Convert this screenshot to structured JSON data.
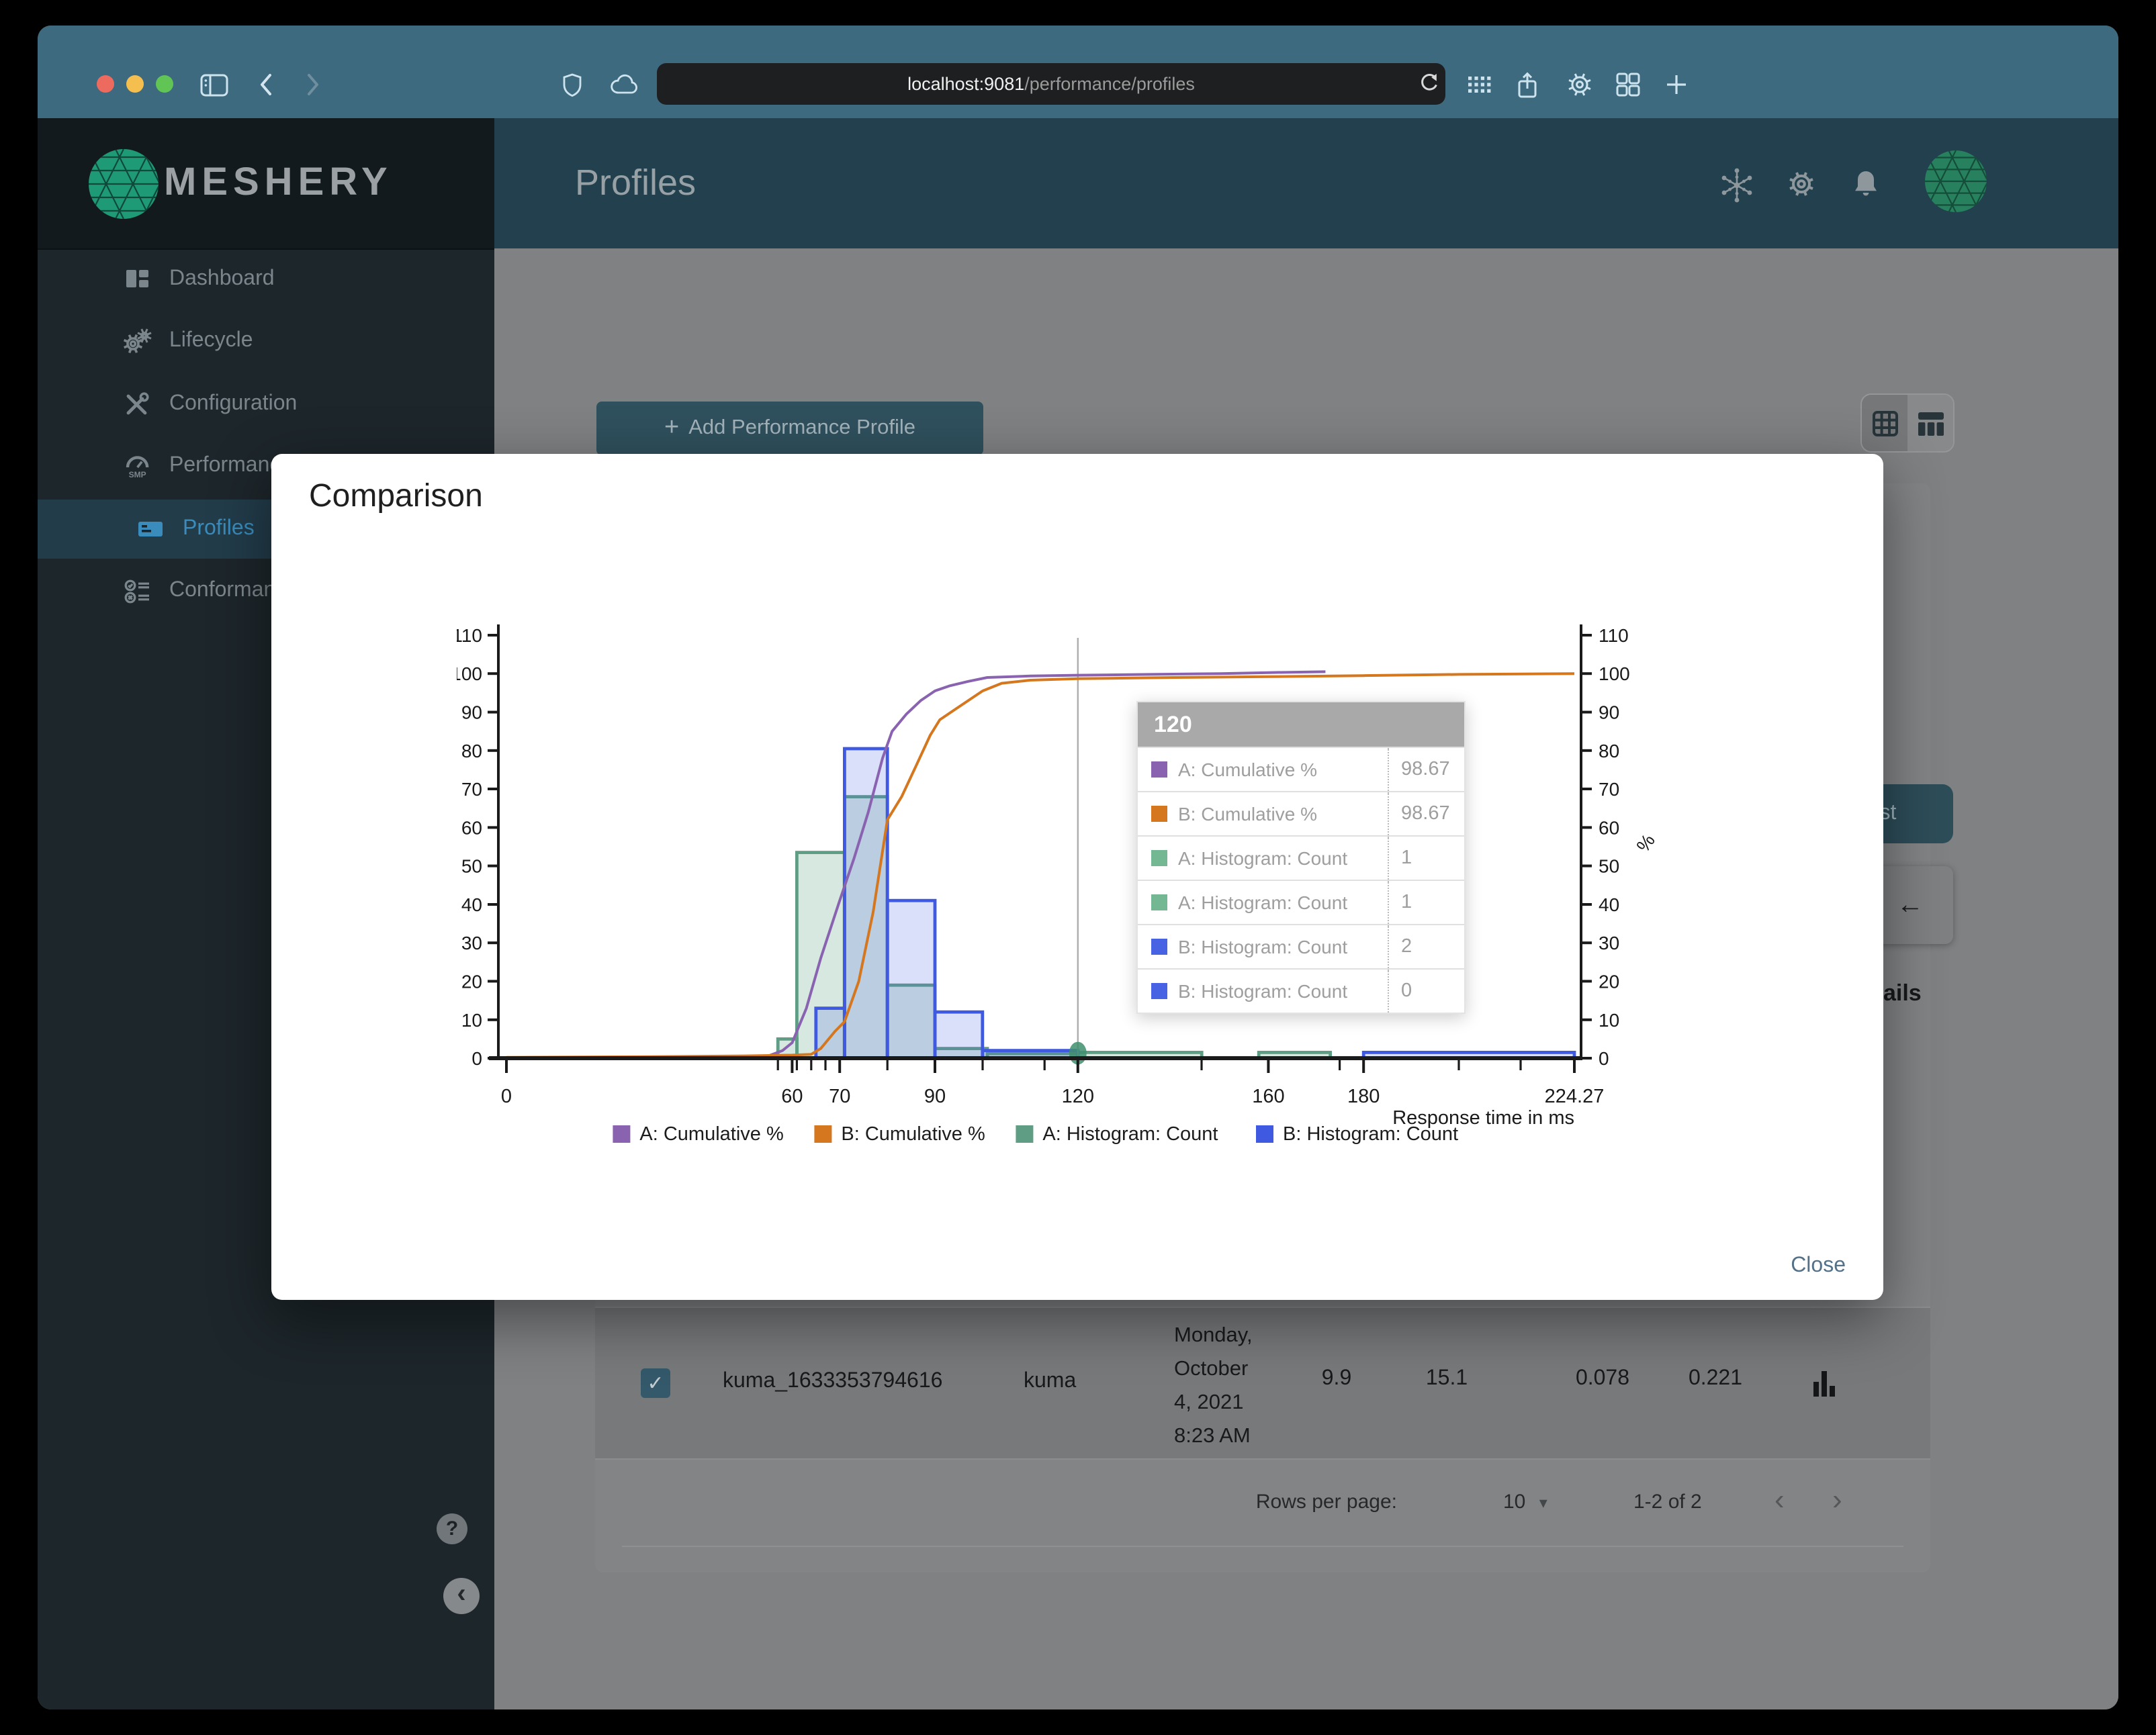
{
  "browser": {
    "url_host": "localhost:9081",
    "url_path": "/performance/profiles"
  },
  "sidebar": {
    "logo": "MESHERY",
    "items": [
      {
        "label": "Dashboard",
        "icon": "dashboard-icon",
        "active": false,
        "indent": false
      },
      {
        "label": "Lifecycle",
        "icon": "lifecycle-icon",
        "active": false,
        "indent": false
      },
      {
        "label": "Configuration",
        "icon": "configuration-icon",
        "active": false,
        "indent": false
      },
      {
        "label": "Performance",
        "icon": "performance-icon",
        "active": false,
        "indent": false,
        "icon_sub": "SMP"
      },
      {
        "label": "Profiles",
        "icon": "profiles-icon",
        "active": true,
        "indent": true
      },
      {
        "label": "Conformance",
        "icon": "conformance-icon",
        "active": false,
        "indent": false
      }
    ],
    "help_glyph": "?",
    "collapse_glyph": "‹"
  },
  "header": {
    "title": "Profiles"
  },
  "page": {
    "plus_glyph": "+",
    "add_profile_label": "Add Performance Profile",
    "test_button": "Test",
    "arrow_glyph": "←",
    "details_partial": "ails",
    "check_glyph": "✓",
    "table_row": {
      "checked": true,
      "name": "kuma_1633353794616",
      "mesh": "kuma",
      "date_lines": [
        "Monday,",
        "October",
        "4, 2021",
        "8:23 AM"
      ],
      "values": [
        "9.9",
        "15.1",
        "0.078",
        "0.221"
      ]
    },
    "pagination": {
      "rows_per_page_label": "Rows per page:",
      "rows_per_page": "10",
      "caret_glyph": "▾",
      "range": "1-2 of 2",
      "prev_glyph": "‹",
      "next_glyph": "›"
    }
  },
  "modal": {
    "title": "Comparison",
    "close_label": "Close"
  },
  "chart_data": {
    "type": "histogram+line",
    "xlabel": "Response time in ms",
    "right_axis_label": "%",
    "xlim": [
      0,
      224.27
    ],
    "ylim": [
      0,
      110
    ],
    "y_tick_step": 10,
    "x_tick_labels": [
      "0",
      "60",
      "70",
      "90",
      "120",
      "160",
      "180",
      "224.27"
    ],
    "x_tick_values": [
      0,
      60,
      70,
      90,
      120,
      160,
      180,
      224.27
    ],
    "x_minor_ticks": [
      57,
      61,
      64,
      67,
      80,
      100,
      113,
      146,
      175,
      200,
      213
    ],
    "legend_position": "bottom",
    "series": [
      {
        "name": "A: Cumulative %",
        "type": "line",
        "color": "#8a63b0",
        "points": [
          [
            30,
            0.1
          ],
          [
            50,
            0.2
          ],
          [
            55,
            0.6
          ],
          [
            58,
            2
          ],
          [
            60,
            4
          ],
          [
            63,
            13
          ],
          [
            66,
            26
          ],
          [
            70,
            41
          ],
          [
            73,
            52
          ],
          [
            76,
            64
          ],
          [
            79,
            78
          ],
          [
            81,
            85
          ],
          [
            84,
            89.5
          ],
          [
            87,
            93
          ],
          [
            90,
            95.5
          ],
          [
            93,
            96.8
          ],
          [
            97,
            98
          ],
          [
            101,
            99
          ],
          [
            110,
            99.4
          ],
          [
            120,
            99.6
          ],
          [
            135,
            99.8
          ],
          [
            150,
            100
          ],
          [
            161,
            100.3
          ],
          [
            172,
            100.5
          ]
        ]
      },
      {
        "name": "B: Cumulative %",
        "type": "line",
        "color": "#d4771e",
        "points": [
          [
            0,
            0.2
          ],
          [
            30,
            0.4
          ],
          [
            50,
            0.6
          ],
          [
            60,
            0.8
          ],
          [
            64,
            1
          ],
          [
            66,
            2.5
          ],
          [
            69,
            7
          ],
          [
            71,
            9.5
          ],
          [
            74,
            20
          ],
          [
            77,
            38
          ],
          [
            80,
            62
          ],
          [
            83,
            68
          ],
          [
            86,
            76
          ],
          [
            89,
            84
          ],
          [
            91,
            88
          ],
          [
            94,
            90.5
          ],
          [
            97,
            93
          ],
          [
            100,
            95.5
          ],
          [
            104,
            97.5
          ],
          [
            110,
            98.3
          ],
          [
            120,
            98.67
          ],
          [
            140,
            99
          ],
          [
            160,
            99.2
          ],
          [
            180,
            99.5
          ],
          [
            200,
            99.8
          ],
          [
            224.27,
            100
          ]
        ]
      },
      {
        "name": "A: Histogram: Count",
        "type": "bars",
        "color": "#5f9e85",
        "fill": "rgba(111,174,145,0.28)",
        "bars": [
          [
            57,
            61,
            5
          ],
          [
            61,
            71,
            53.5
          ],
          [
            71,
            80,
            68
          ],
          [
            80,
            90,
            19
          ],
          [
            90,
            101,
            2.5
          ],
          [
            101,
            120,
            1.2
          ],
          [
            120,
            146,
            1.5
          ],
          [
            158,
            173,
            1.5
          ]
        ]
      },
      {
        "name": "B: Histogram: Count",
        "type": "bars",
        "color": "#3f5ae0",
        "fill": "rgba(77,100,228,0.20)",
        "bars": [
          [
            65,
            71,
            13
          ],
          [
            71,
            80,
            80.5
          ],
          [
            80,
            90,
            41
          ],
          [
            90,
            100,
            12
          ],
          [
            100,
            120,
            2
          ],
          [
            180,
            224.27,
            1.5
          ]
        ]
      }
    ],
    "crosshair_x": 120,
    "hover_marker": {
      "x": 120,
      "y": 1.3,
      "color": "#3f8f6e"
    },
    "tooltip": {
      "title": "120",
      "rows": [
        {
          "swatch": "#8a63b0",
          "label": "A: Cumulative %",
          "value": "98.67"
        },
        {
          "swatch": "#d4771e",
          "label": "B: Cumulative %",
          "value": "98.67"
        },
        {
          "swatch": "#74b793",
          "label": "A: Histogram: Count",
          "value": "1"
        },
        {
          "swatch": "#74b793",
          "label": "A: Histogram: Count",
          "value": "1"
        },
        {
          "swatch": "#4762e3",
          "label": "B: Histogram: Count",
          "value": "2"
        },
        {
          "swatch": "#4762e3",
          "label": "B: Histogram: Count",
          "value": "0"
        }
      ]
    }
  }
}
